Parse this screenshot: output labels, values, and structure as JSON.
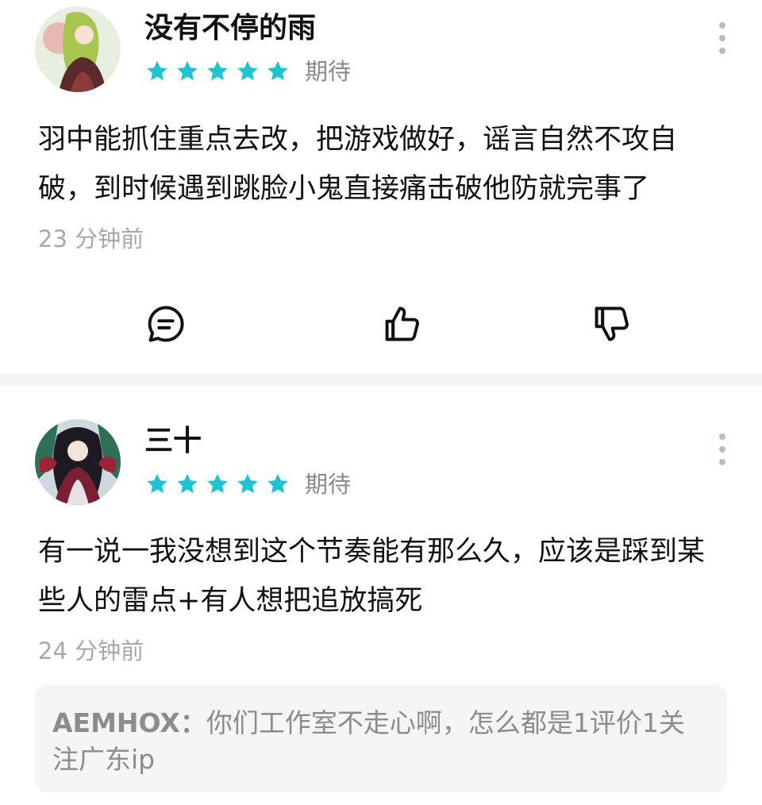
{
  "reviews": [
    {
      "username": "没有不停的雨",
      "rating_stars": 5,
      "rating_label": "期待",
      "comment": "羽中能抓住重点去改，把游戏做好，谣言自然不攻自破，到时候遇到跳脸小鬼直接痛击破他防就完事了",
      "time": "23 分钟前"
    },
    {
      "username": "三十",
      "rating_stars": 5,
      "rating_label": "期待",
      "comment": "有一说一我没想到这个节奏能有那么久，应该是踩到某些人的雷点+有人想把追放搞死",
      "time": "24 分钟前",
      "reply": {
        "author": "AEMHOX：",
        "text": "你们工作室不走心啊，怎么都是1评价1关注广东ip"
      }
    }
  ],
  "colors": {
    "star": "#1fc4cf",
    "muted_text": "#8a8a8a",
    "divider": "#f3f4f6",
    "reply_bg": "#f4f5f7"
  },
  "icons": {
    "reply": "comment-bubble-icon",
    "like": "thumbs-up-icon",
    "dislike": "thumbs-down-icon",
    "more": "more-vertical-icon"
  }
}
